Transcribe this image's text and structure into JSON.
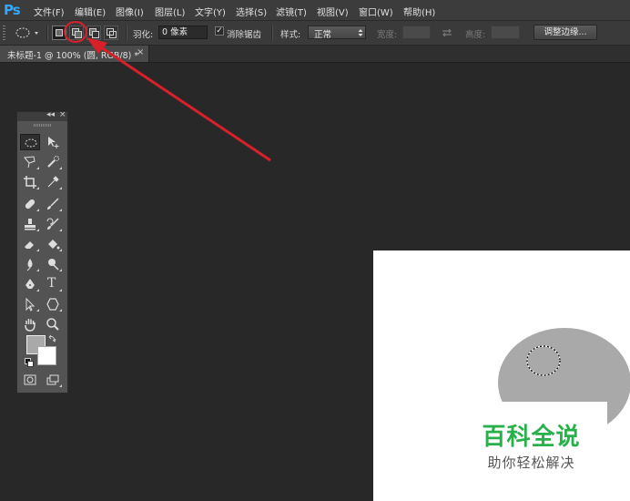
{
  "app": {
    "logo": "Ps"
  },
  "menu": [
    "文件(F)",
    "编辑(E)",
    "图像(I)",
    "图层(L)",
    "文字(Y)",
    "选择(S)",
    "滤镜(T)",
    "视图(V)",
    "窗口(W)",
    "帮助(H)"
  ],
  "options": {
    "feather_label": "羽化:",
    "feather_value": "0 像素",
    "antialias_label": "消除锯齿",
    "antialias_checked": "✓",
    "style_label": "样式:",
    "style_value": "正常",
    "width_label": "宽度:",
    "height_label": "高度:",
    "refine_edge_label": "调整边缘..."
  },
  "document": {
    "tab_title": "未标题-1 @ 100% (圆, RGB/8) *",
    "close_glyph": "×"
  },
  "tools_panel": {
    "collapse_glyph": "◂◂",
    "close_glyph": "×",
    "text_tool_glyph": "T",
    "foreground_color": "#a9a9a9",
    "background_color": "#ffffff"
  },
  "annotation": {
    "color": "#d8202a"
  },
  "watermark": {
    "title": "百科全说",
    "subtitle": "助你轻松解决"
  },
  "colors": {
    "workspace": "#282828",
    "accent": "#31a8ff",
    "ellipse": "#a9a9a9"
  }
}
